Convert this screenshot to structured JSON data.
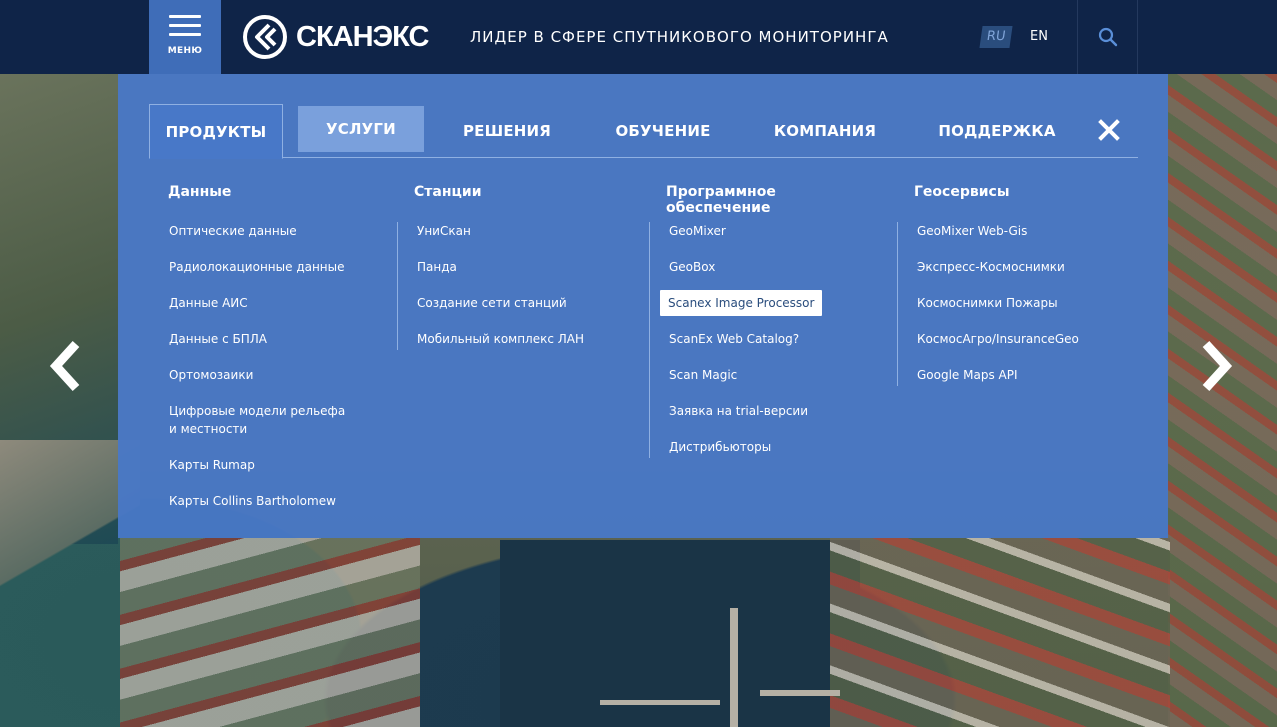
{
  "header": {
    "menu_label": "МЕНЮ",
    "logo_text": "СКАНЭКС",
    "tagline": "ЛИДЕР В СФЕРЕ СПУТНИКОВОГО МОНИТОРИНГА",
    "lang_active": "RU",
    "lang_other": "EN"
  },
  "tabs": [
    {
      "label": "ПРОДУКТЫ"
    },
    {
      "label": "УСЛУГИ"
    },
    {
      "label": "РЕШЕНИЯ"
    },
    {
      "label": "ОБУЧЕНИЕ"
    },
    {
      "label": "КОМПАНИЯ"
    },
    {
      "label": "ПОДДЕРЖКА"
    }
  ],
  "columns": [
    {
      "title": "Данные",
      "items": [
        "Оптические данные",
        "Радиолокационные данные",
        "Данные АИС",
        "Данные с БПЛА",
        "Ортомозаики",
        "Цифровые модели рельефа и местности",
        "Карты Rumap",
        "Карты Collins Bartholomew"
      ]
    },
    {
      "title": "Станции",
      "items": [
        "УниСкан",
        "Панда",
        "Создание сети станций",
        "Мобильный комплекс ЛАН"
      ]
    },
    {
      "title": "Программное обеспечение",
      "items": [
        "GeoMixer",
        "GeoBox",
        "Scanex Image Processor",
        "ScanEx Web Catalog?",
        "Scan Magic",
        "Заявка на trial-версии",
        "Дистрибьюторы"
      ]
    },
    {
      "title": "Геосервисы",
      "items": [
        "GeoMixer Web-Gis",
        "Экспресс-Космоснимки",
        "Космоснимки Пожары",
        "КосмосАгро/InsuranceGeo",
        "Google Maps API"
      ]
    }
  ],
  "colors": {
    "header_bg": "#0f2448",
    "accent": "#3f6db8",
    "menu_panel": "#4878c8"
  }
}
